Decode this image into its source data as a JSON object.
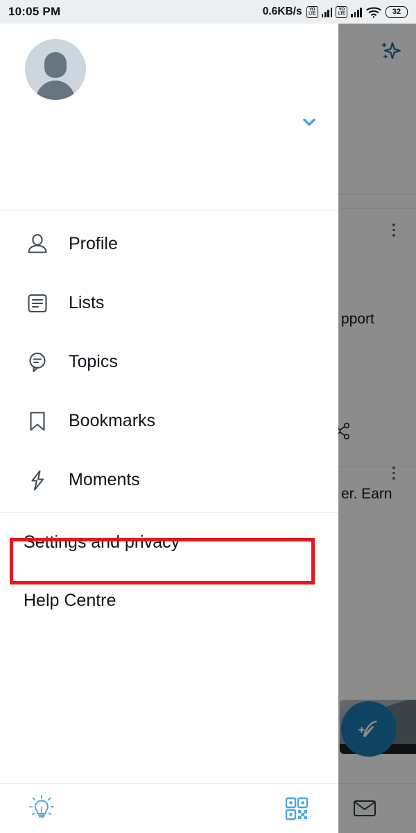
{
  "status_bar": {
    "clock": "10:05 PM",
    "network_speed": "0.6KB/s",
    "sim1_label": "VoLTE",
    "sim2_label": "VoLTE",
    "wifi_icon": "wifi-icon",
    "battery_level": "32"
  },
  "drawer": {
    "avatar_icon": "avatar-placeholder-icon",
    "account_switch_icon": "chevron-down-icon",
    "menu_items": [
      {
        "label": "Profile",
        "icon": "person-icon"
      },
      {
        "label": "Lists",
        "icon": "list-icon"
      },
      {
        "label": "Topics",
        "icon": "topics-speech-bubble-icon"
      },
      {
        "label": "Bookmarks",
        "icon": "bookmark-icon"
      },
      {
        "label": "Moments",
        "icon": "lightning-bolt-icon"
      }
    ],
    "secondary_items": [
      {
        "label": "Settings and privacy",
        "highlighted": true
      },
      {
        "label": "Help Centre",
        "highlighted": false
      }
    ],
    "bottom_bar": {
      "left_icon": "lightbulb-icon",
      "right_icon": "qr-code-icon"
    }
  },
  "background": {
    "sparkle_icon": "sparkle-icon",
    "share_icon": "share-icon",
    "overflow_icon": "more-vertical-icon",
    "compose_icon": "compose-feather-icon",
    "mail_icon": "mail-envelope-icon",
    "partial_text_1": "pport",
    "partial_text_2": "er. Earn"
  },
  "annotation": {
    "highlight_target": "Settings and privacy",
    "highlight_color": "#e8161f"
  },
  "colors": {
    "accent_blue": "#4aa3df",
    "fab_blue": "#1d7bb3",
    "icon_gray": "#3f4c54",
    "text_primary": "#0f1419",
    "status_bar_bg": "#eceff1",
    "divider": "#eaeef0",
    "avatar_bg": "#ccd6dd",
    "avatar_fg": "#66757f"
  }
}
